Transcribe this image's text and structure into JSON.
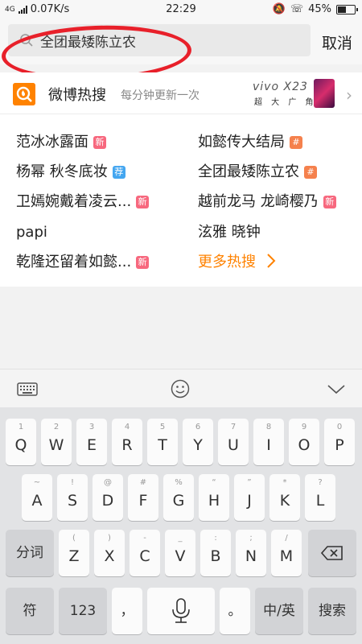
{
  "status_bar": {
    "network": "4G",
    "speed": "0.07K/s",
    "time": "22:29",
    "battery": "45%",
    "battery_level": 0.45
  },
  "search": {
    "value": "全团最矮陈立农",
    "cancel_label": "取消"
  },
  "hot": {
    "title": "微博热搜",
    "subtitle": "每分钟更新一次",
    "ad": {
      "brand": "vivo X23",
      "tagline": "超 大 广 角"
    },
    "left": [
      {
        "text": "范冰冰露面",
        "badge": "新"
      },
      {
        "text": "杨幂 秋冬底妆",
        "badge": "荐"
      },
      {
        "text": "卫嫣婉戴着凌云...",
        "badge": "新"
      },
      {
        "text": "papi",
        "badge": ""
      },
      {
        "text": "乾隆还留着如懿...",
        "badge": "新"
      }
    ],
    "right": [
      {
        "text": "如懿传大结局",
        "badge": "#"
      },
      {
        "text": "全团最矮陈立农",
        "badge": "#"
      },
      {
        "text": "越前龙马 龙崎樱乃",
        "badge": "新"
      },
      {
        "text": "泫雅 晓钟",
        "badge": ""
      }
    ],
    "more_label": "更多热搜"
  },
  "keyboard": {
    "row1": [
      {
        "hint": "1",
        "label": "Q"
      },
      {
        "hint": "2",
        "label": "W"
      },
      {
        "hint": "3",
        "label": "E"
      },
      {
        "hint": "4",
        "label": "R"
      },
      {
        "hint": "5",
        "label": "T"
      },
      {
        "hint": "6",
        "label": "Y"
      },
      {
        "hint": "7",
        "label": "U"
      },
      {
        "hint": "8",
        "label": "I"
      },
      {
        "hint": "9",
        "label": "O"
      },
      {
        "hint": "0",
        "label": "P"
      }
    ],
    "row2": [
      {
        "hint": "~",
        "label": "A"
      },
      {
        "hint": "!",
        "label": "S"
      },
      {
        "hint": "@",
        "label": "D"
      },
      {
        "hint": "#",
        "label": "F"
      },
      {
        "hint": "%",
        "label": "G"
      },
      {
        "hint": "“",
        "label": "H"
      },
      {
        "hint": "”",
        "label": "J"
      },
      {
        "hint": "*",
        "label": "K"
      },
      {
        "hint": "?",
        "label": "L"
      }
    ],
    "row3": [
      {
        "hint": "(",
        "label": "Z"
      },
      {
        "hint": ")",
        "label": "X"
      },
      {
        "hint": "-",
        "label": "C"
      },
      {
        "hint": "_",
        "label": "V"
      },
      {
        "hint": ":",
        "label": "B"
      },
      {
        "hint": ";",
        "label": "N"
      },
      {
        "hint": "/",
        "label": "M"
      }
    ],
    "segment_label": "分词",
    "symbol_label": "符",
    "number_label": "123",
    "comma_label": "，",
    "period_label": "。",
    "lang_label": "中/英",
    "search_label": "搜索"
  }
}
